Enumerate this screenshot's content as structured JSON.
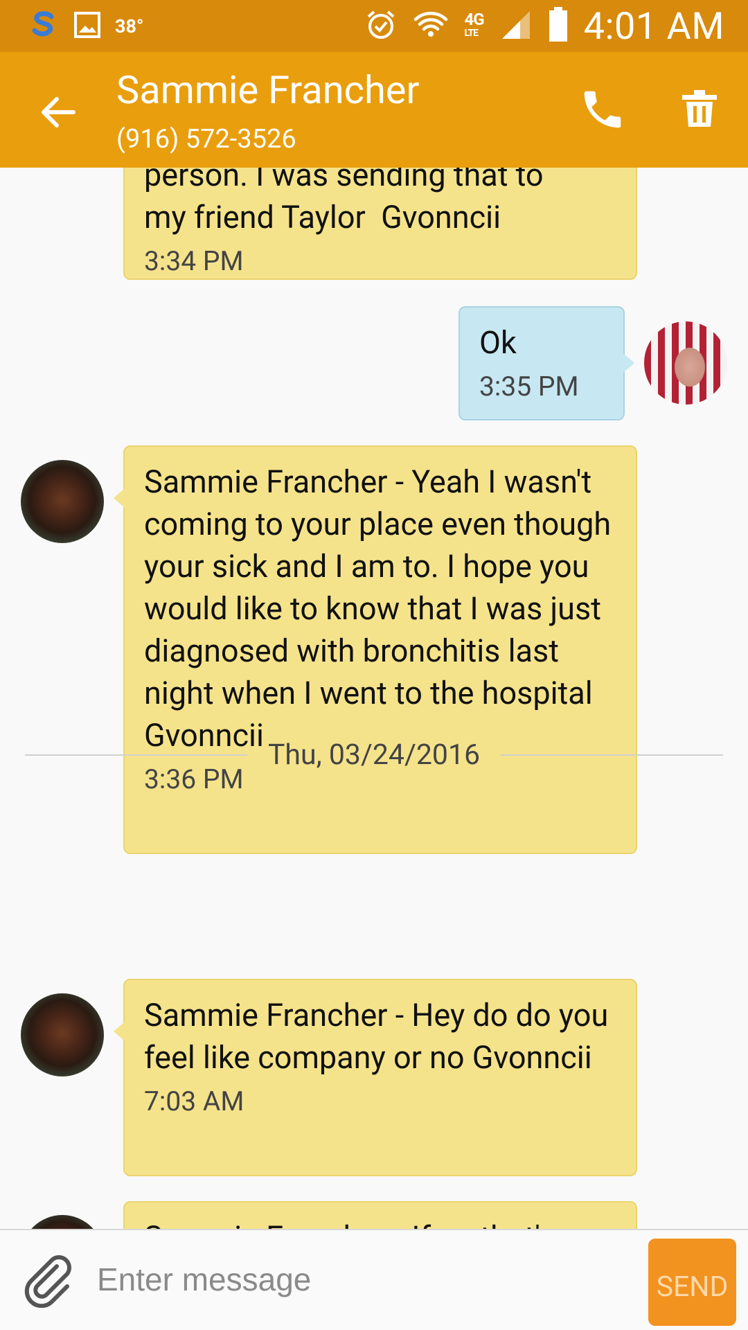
{
  "status_bar": {
    "temperature": "38°",
    "network": "4G",
    "network_sub": "LTE",
    "time": "4:01 AM",
    "icons": [
      "s-app-icon",
      "gallery-icon",
      "alarm-icon",
      "wifi-icon",
      "signal-icon",
      "battery-icon"
    ]
  },
  "header": {
    "contact_name": "Sammie Francher",
    "phone": "(916) 572-3526",
    "actions": [
      "back-arrow-icon",
      "phone-icon",
      "trash-icon"
    ]
  },
  "messages": [
    {
      "direction": "incoming",
      "partial": true,
      "text_visible": "person. I was sending that to\nmy friend Taylor  Gvonncii",
      "time": "3:34 PM"
    },
    {
      "direction": "outgoing",
      "text": "Ok",
      "time": "3:35 PM"
    },
    {
      "direction": "incoming",
      "text": "Sammie Francher - Yeah I wasn't coming to your place even though your sick and I am to. I hope you would like to know that I was just diagnosed with bronchitis last night when I went to the hospital  Gvonncii",
      "time": "3:36 PM"
    },
    {
      "direction": "incoming",
      "text": "Sammie Francher - Hey do do you feel like company or no Gvonncii",
      "time": "7:03 AM"
    },
    {
      "direction": "incoming",
      "partial": true,
      "text_visible": "Sammie Francher - If so that's",
      "time": ""
    }
  ],
  "date_separator": "Thu, 03/24/2016",
  "composer": {
    "placeholder": "Enter message",
    "send_label": "SEND"
  },
  "colors": {
    "status_bar": "#d88a0c",
    "app_bar": "#e99e0d",
    "incoming_bubble": "#f5e38c",
    "outgoing_bubble": "#c7e8f2",
    "send_button": "#f2921f"
  }
}
